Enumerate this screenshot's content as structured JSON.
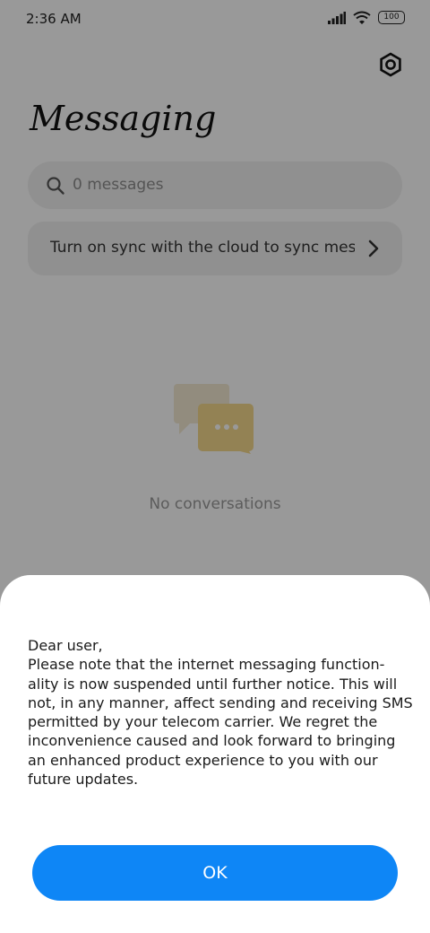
{
  "status_bar": {
    "time": "2:36 AM",
    "battery": "100",
    "icons": [
      "signal-icon",
      "wifi-icon",
      "battery-icon"
    ]
  },
  "header": {
    "title": "Messaging",
    "settings_icon": "gear-icon"
  },
  "search": {
    "placeholder": "0 messages",
    "icon": "search-icon"
  },
  "sync_banner": {
    "text": "Turn on sync with the cloud to sync messages",
    "icon": "chevron-right-icon"
  },
  "empty_state": {
    "text": "No conversations",
    "icon": "chat-bubbles-icon"
  },
  "dialog": {
    "message": "Dear user,\nPlease note that the internet messaging function-\nality is now suspended until further notice. This will\nnot, in any manner, affect sending and receiving SMS\npermitted by your telecom carrier. We regret the\ninconvenience caused and look forward to bringing\nan enhanced product experience to you with our\nfuture updates.",
    "ok_label": "OK"
  },
  "colors": {
    "accent": "#0e86f6",
    "overlay": "rgba(0,0,0,0.4)",
    "surface": "#f1f1f1",
    "chat_bubble_back": "#f3ead2",
    "chat_bubble_front": "#f6d98d"
  }
}
